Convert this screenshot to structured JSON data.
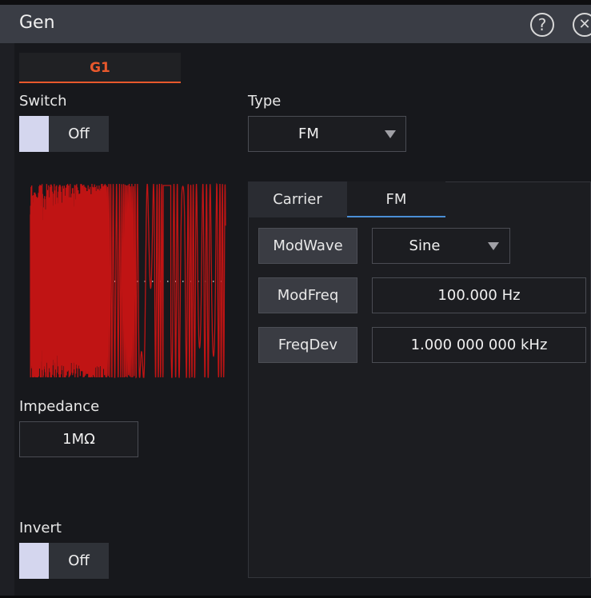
{
  "window": {
    "title": "Gen"
  },
  "title_buttons": {
    "help": "?",
    "close": "✕"
  },
  "channel_tab": {
    "label": "G1"
  },
  "switch": {
    "label": "Switch",
    "state": "Off"
  },
  "type": {
    "label": "Type",
    "value": "FM"
  },
  "impedance": {
    "label": "Impedance",
    "value": "1MΩ"
  },
  "invert": {
    "label": "Invert",
    "state": "Off"
  },
  "subtabs": {
    "carrier": "Carrier",
    "fm": "FM"
  },
  "mod_wave": {
    "label": "ModWave",
    "value": "Sine"
  },
  "mod_freq": {
    "label": "ModFreq",
    "value": "100.000 Hz"
  },
  "freq_dev": {
    "label": "FreqDev",
    "value": "1.000 000 000 kHz"
  },
  "colors": {
    "accent": "#e8582c",
    "wave": "#c01414",
    "tab_underline": "#4a8fd6",
    "toggle_knob": "#d4d6ee"
  }
}
